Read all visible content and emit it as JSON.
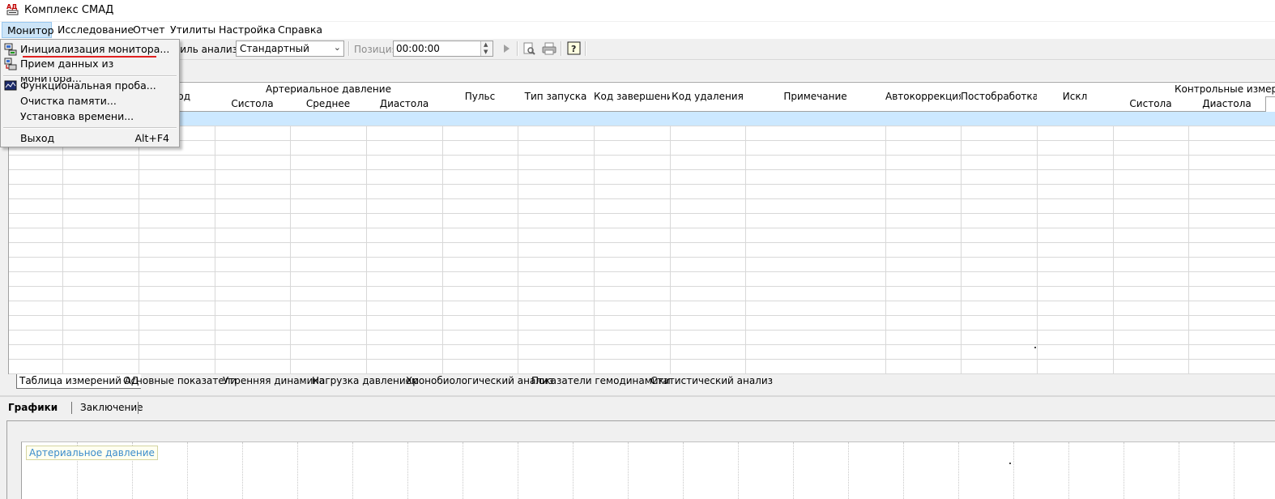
{
  "window": {
    "title": "Комплекс СМАД",
    "icon": "app-ad-icon"
  },
  "menubar": [
    {
      "label": "Монитор",
      "active": true
    },
    {
      "label": "Исследование"
    },
    {
      "label": "Отчет"
    },
    {
      "label": "Утилиты"
    },
    {
      "label": "Настройка"
    },
    {
      "label": "Справка"
    }
  ],
  "toolbar": {
    "profile_label": "филь анализа",
    "profile_value": "Стандартный",
    "position_label": "Позиция",
    "position_value": "00:00:00",
    "icons": [
      "play-icon",
      "print-preview-icon",
      "print-icon",
      "help-icon"
    ]
  },
  "grid": {
    "headers": {
      "col3": "од",
      "arterial": "Артериальное давление",
      "systole": "Систола",
      "mean": "Среднее",
      "diastole": "Диастола",
      "pulse": "Пульс",
      "launch_type": "Тип запуска",
      "end_code": "Код завершения",
      "delete_code": "Код удаления",
      "note": "Примечание",
      "autocorrection": "Автокоррекция",
      "postprocessing": "Постобработка",
      "excl": "Искл",
      "control": "Контрольные измерения",
      "c_systole": "Систола",
      "c_diastole": "Диастола"
    }
  },
  "sheet_tabs": [
    "Таблица измерений АД",
    "Основные показатели",
    "Утренняя динамика",
    "Нагрузка давлением",
    "Хронобиологический анализ",
    "Показатели гемодинамики",
    "Статистический анализ"
  ],
  "lower_tabs": [
    "Графики АД",
    "Заключение"
  ],
  "chart": {
    "title": "Артериальное давление",
    "title_color": "#3b8ccc"
  },
  "monitor_menu": {
    "items": [
      {
        "label": "Инициализация монитора...",
        "icon": "monitor-init-icon",
        "highlighted": true
      },
      {
        "label": "Прием данных из монитора...",
        "icon": "monitor-receive-icon"
      },
      {
        "label": "Функциональная проба...",
        "icon": "function-test-icon"
      },
      {
        "label": "Очистка памяти..."
      },
      {
        "label": "Установка времени..."
      },
      {
        "label": "Выход",
        "shortcut": "Alt+F4"
      }
    ]
  },
  "colors": {
    "selection_row": "#cce8ff",
    "menu_active": "#cce4f7",
    "underline": "#e02020"
  }
}
